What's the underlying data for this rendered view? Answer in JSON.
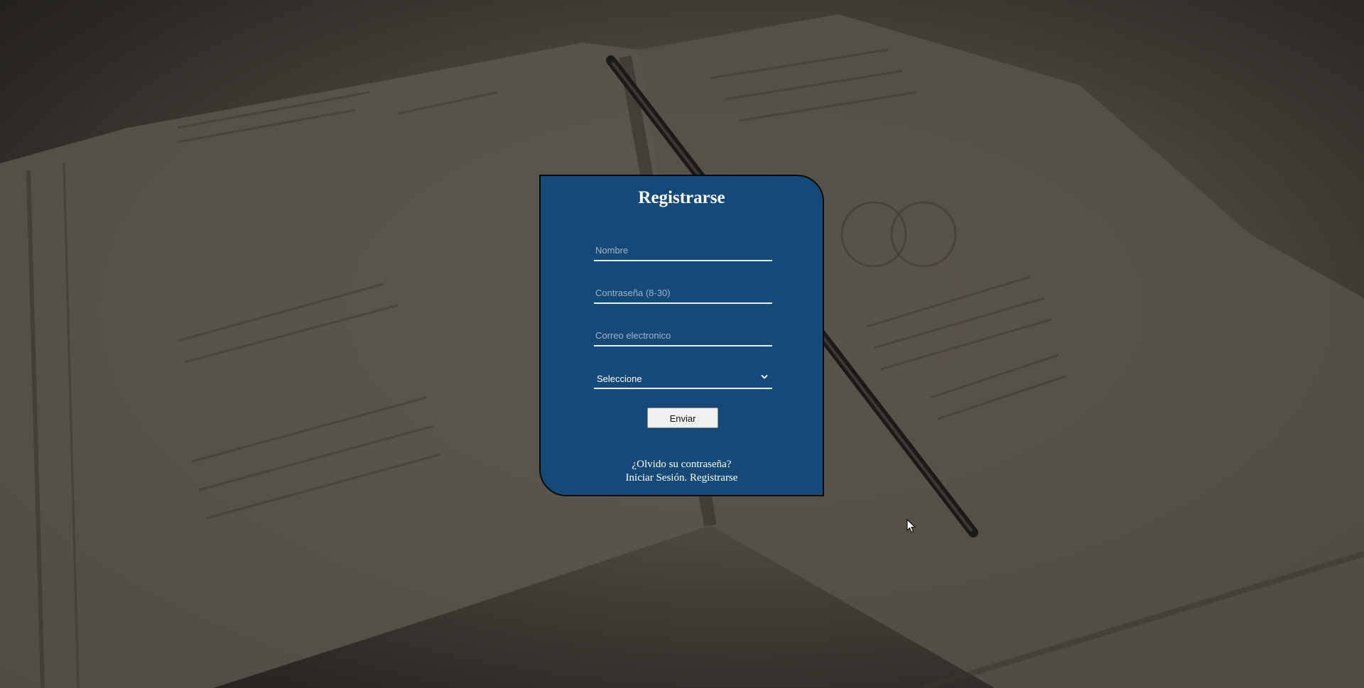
{
  "form": {
    "title": "Registrarse",
    "name_placeholder": "Nombre",
    "password_placeholder": "Contraseña (8-30)",
    "email_placeholder": "Correo electronico",
    "select_value": "Seleccione",
    "submit_label": "Enviar"
  },
  "links": {
    "forgot_password": "¿Olvido su contraseña?",
    "login": "Iniciar Sesión.",
    "register": "Registrarse"
  },
  "colors": {
    "card_background": "#154a78",
    "card_border": "#0b0b0b",
    "button_background": "#efefef"
  }
}
